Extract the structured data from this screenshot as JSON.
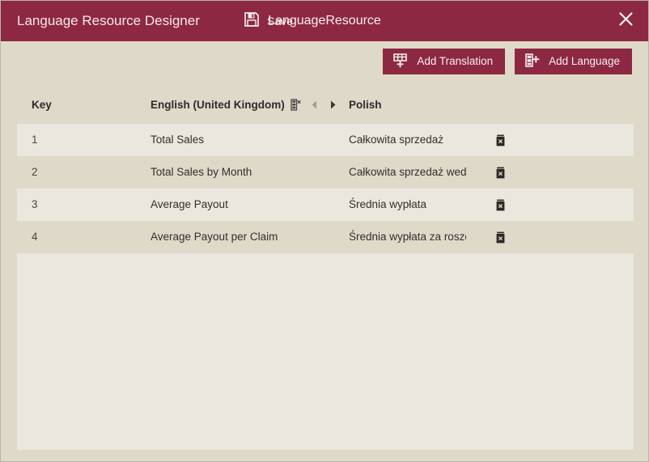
{
  "window": {
    "accent_color": "#8d2842",
    "background_color": "#ded9c9",
    "grid_row_light": "#eae7de",
    "grid_row_dark": "#ded9c9"
  },
  "titlebar": {
    "app_title": "Language Resource Designer",
    "save_label": "Save",
    "save_icon": "floppy-disk-save-icon",
    "document_title": "LanguageResource",
    "close_icon": "close-icon"
  },
  "toolbar": {
    "buttons": [
      {
        "label": "Add Translation",
        "icon": "add-translation-grid-plus-icon"
      },
      {
        "label": "Add Language",
        "icon": "add-language-column-plus-icon"
      }
    ]
  },
  "grid": {
    "headers": {
      "key": "Key",
      "language_1": "English (United Kingdom)",
      "language_2": "Polish"
    },
    "column_tools": [
      {
        "name": "delete-column-icon",
        "enabled": true
      },
      {
        "name": "move-column-left-icon",
        "enabled": false
      },
      {
        "name": "move-column-right-icon",
        "enabled": true
      }
    ],
    "rows": [
      {
        "key": "1",
        "english": "Total Sales",
        "polish": "Całkowita sprzedaż",
        "delete_icon": "delete-row-icon"
      },
      {
        "key": "2",
        "english": "Total Sales by Month",
        "polish": "Całkowita sprzedaż według miesiąca",
        "delete_icon": "delete-row-icon"
      },
      {
        "key": "3",
        "english": "Average Payout",
        "polish": "Średnia wypłata",
        "delete_icon": "delete-row-icon"
      },
      {
        "key": "4",
        "english": "Average Payout per Claim",
        "polish": "Średnia wypłata za roszczenie",
        "delete_icon": "delete-row-icon"
      }
    ]
  }
}
